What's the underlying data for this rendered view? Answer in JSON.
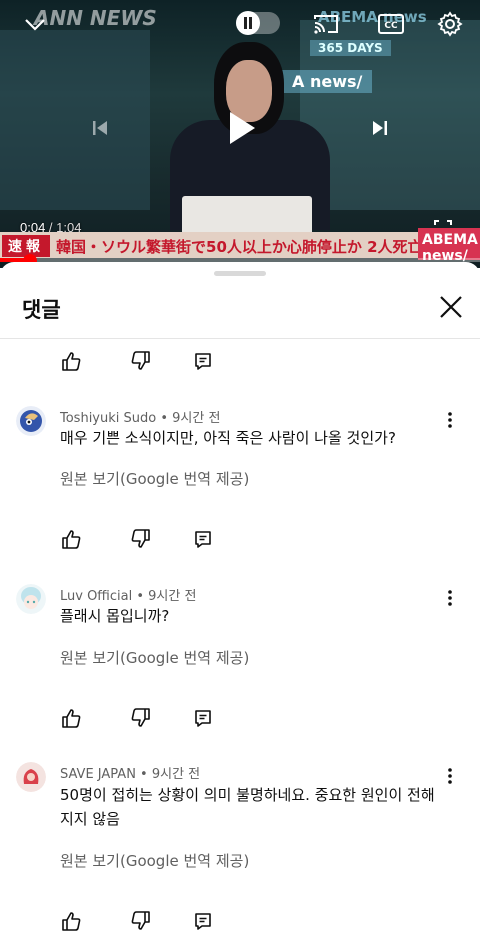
{
  "player": {
    "time_current": "0:04",
    "time_separator": " / ",
    "time_duration": "1:04",
    "progress_fraction": 0.0625,
    "ticker_badge": "速報",
    "ticker_text": "韓国・ソウル繁華街で50人以上か心肺停止か 2人死亡",
    "ticker_logo": "ABEMA news/",
    "brand_mark": "ANN NEWS",
    "bg_sign_1": "ABEMA news",
    "bg_sign_2": "365 DAYS",
    "bg_sign_3": "A news/",
    "icons": [
      "chevron-down-icon",
      "pause-icon",
      "cast-icon",
      "captions-icon",
      "settings-icon",
      "previous-icon",
      "play-icon",
      "next-icon",
      "fullscreen-icon"
    ]
  },
  "sheet": {
    "title": "댓글"
  },
  "comments": [
    {
      "author": "Toshiyuki Sudo",
      "time": "9시간 전",
      "text": "매우 기쁜 소식이지만, 아직 죽은 사람이 나올 것인가?",
      "translate": "원본 보기(Google 번역 제공)",
      "avatar_color": "#3355aa"
    },
    {
      "author": "Luv Official",
      "time": "9시간 전",
      "text": "플래시 몹입니까?",
      "translate": "원본 보기(Google 번역 제공)",
      "avatar_color": "#bfe3ec"
    },
    {
      "author": "SAVE JAPAN",
      "time": "9시간 전",
      "text": "50명이 접히는 상황이 의미 불명하네요. 중요한 원인이 전해지지 않음",
      "translate": "원본 보기(Google 번역 제공)",
      "avatar_color": "#d9414b"
    }
  ],
  "meta_separator": " • ",
  "colors": {
    "accent_red": "#ff0000",
    "ticker_red": "#c4182c"
  }
}
